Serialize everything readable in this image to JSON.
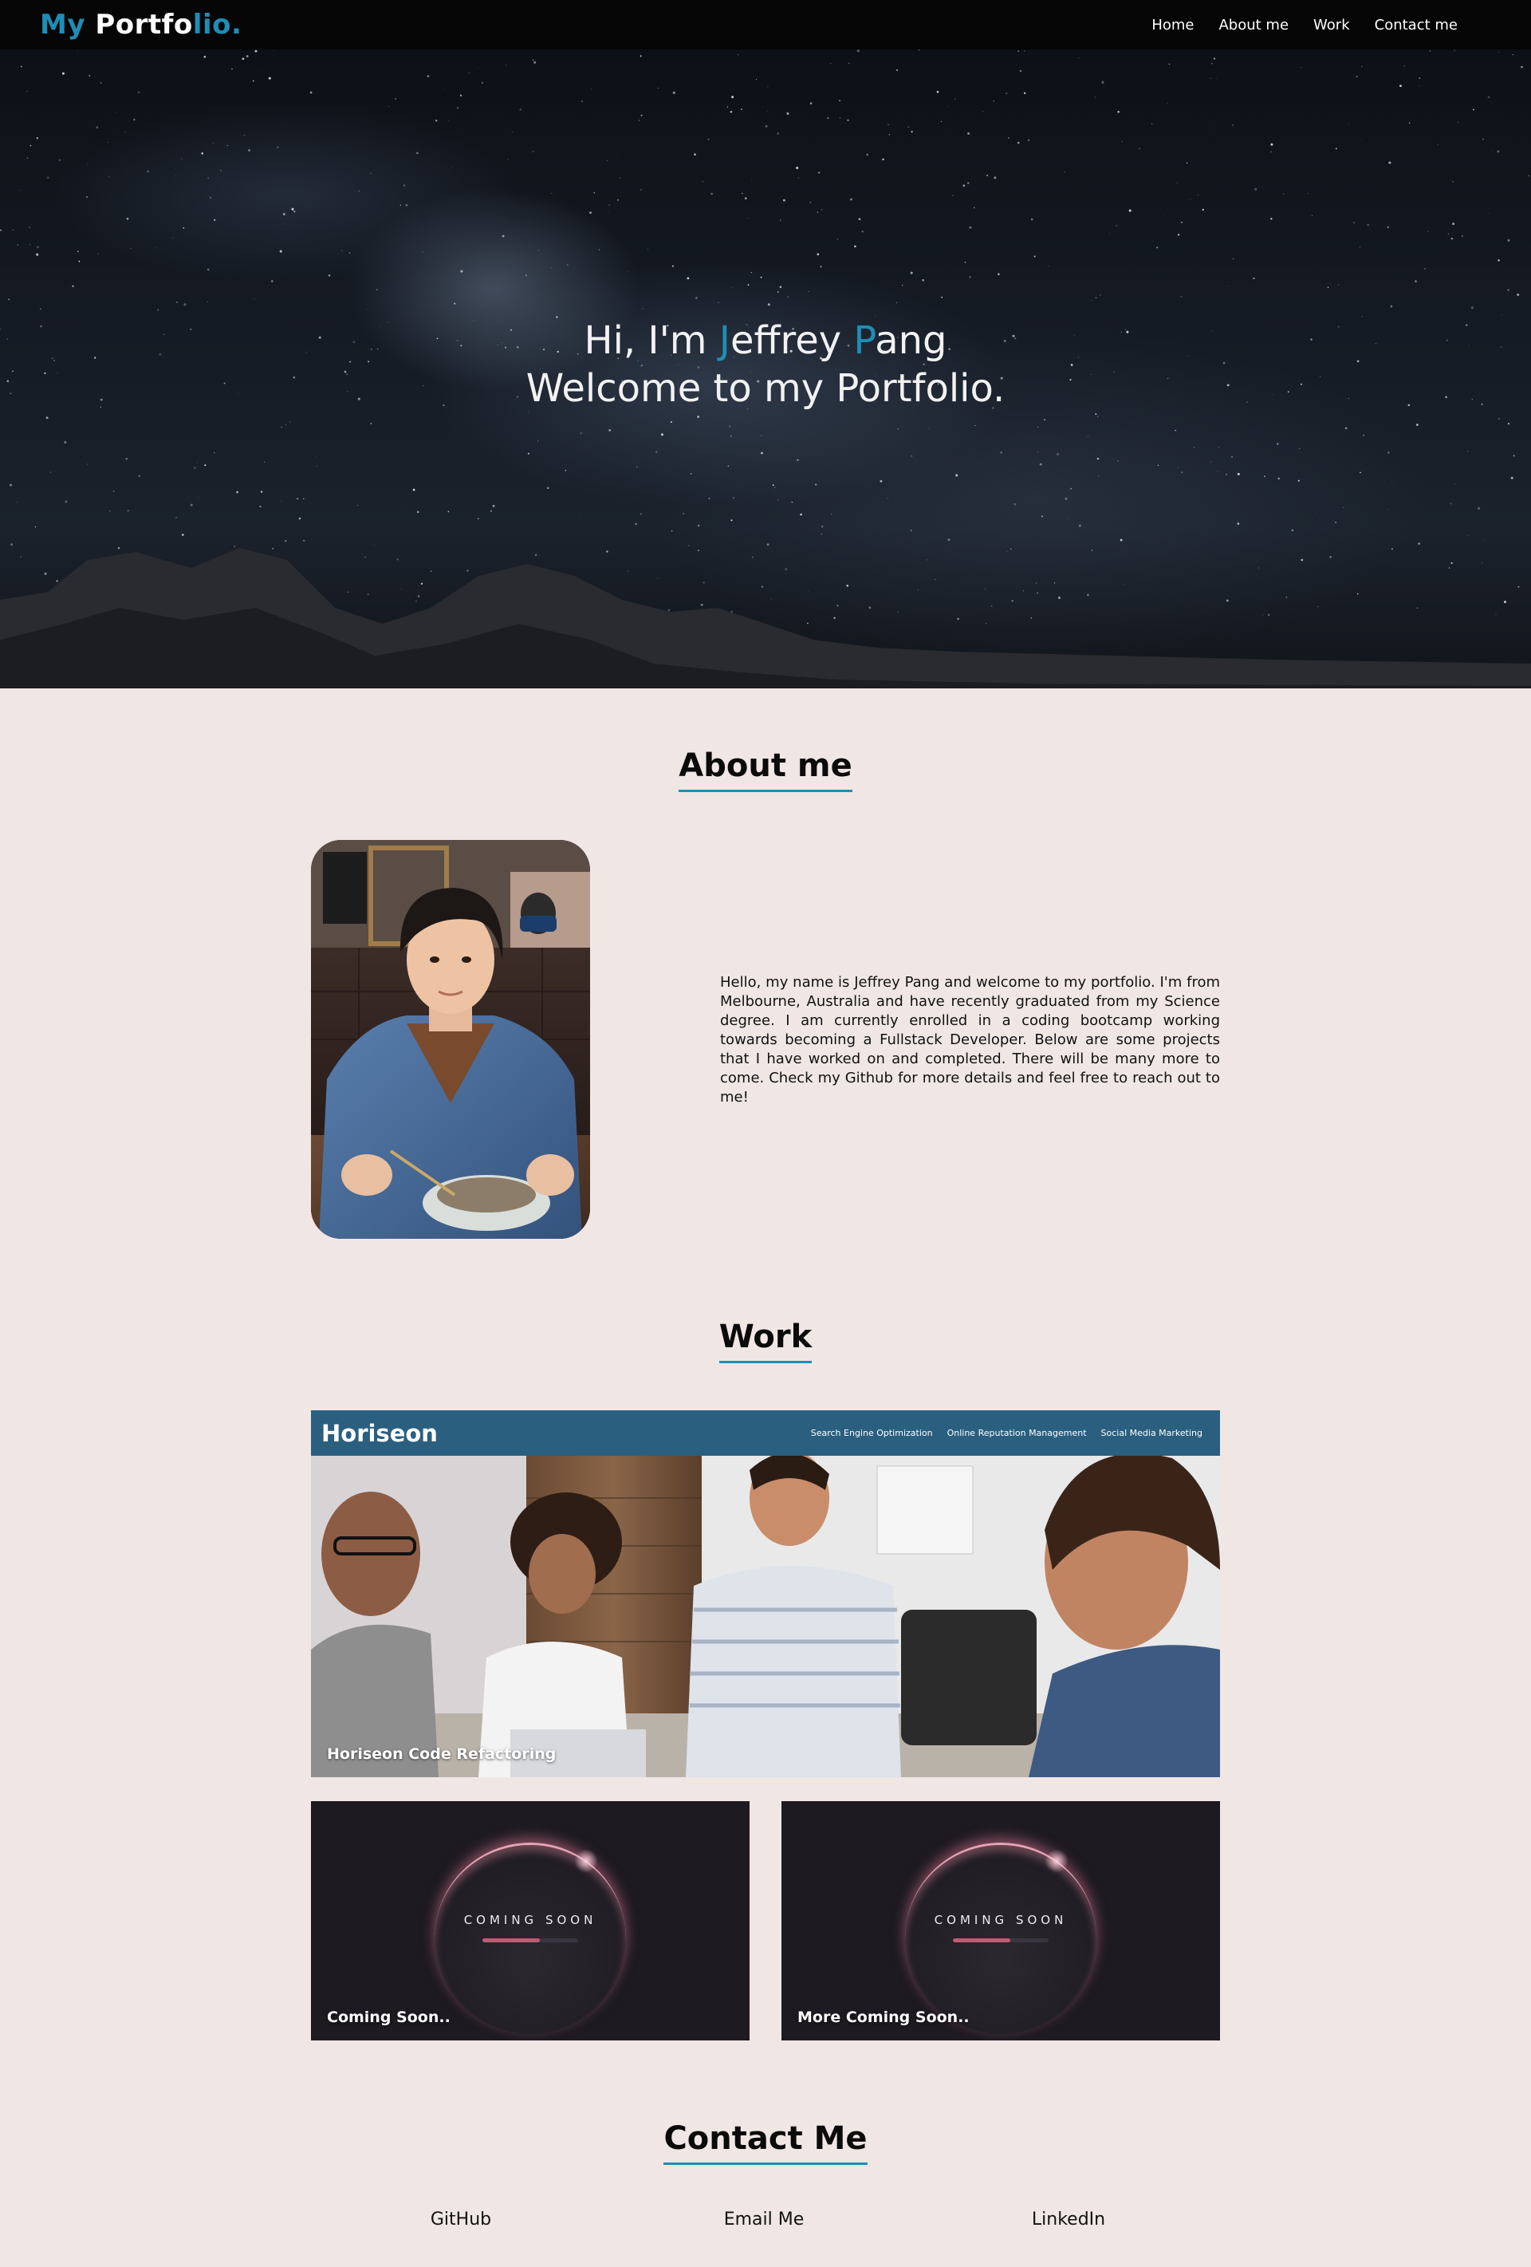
{
  "nav": {
    "brand": {
      "part1": "My ",
      "part2": "Portfo",
      "part3": "lio."
    },
    "links": [
      "Home",
      "About me",
      "Work",
      "Contact me"
    ]
  },
  "hero": {
    "line1_pre": "Hi, I'm ",
    "line1_j": "J",
    "line1_mid": "effrey ",
    "line1_p": "P",
    "line1_end": "ang",
    "line2": "Welcome to my Portfolio."
  },
  "about": {
    "title": "About me",
    "text": "Hello, my name is Jeffrey Pang and welcome to my portfolio. I'm from Melbourne, Australia and have recently graduated from my Science degree. I am currently enrolled in a coding bootcamp working towards becoming a Fullstack Developer. Below are some projects that I have worked on and completed. There will be many more to come. Check my Github for more details and feel free to reach out to me!"
  },
  "work": {
    "title": "Work",
    "featured": {
      "label": "Horiseon Code Refactoring",
      "preview_logo": "Horiseon",
      "preview_nav": [
        "Search Engine Optimization",
        "Online Reputation Management",
        "Social Media Marketing"
      ]
    },
    "cards": [
      {
        "label": "Coming Soon..",
        "image_text": "COMING SOON",
        "progress": 0.6
      },
      {
        "label": "More Coming Soon..",
        "image_text": "COMING SOON",
        "progress": 0.6
      }
    ]
  },
  "contact": {
    "title": "Contact Me",
    "links": [
      "GitHub",
      "Email Me",
      "LinkedIn"
    ]
  },
  "colors": {
    "accent": "#1e8eb6",
    "nav_bg": "#050505",
    "page_bg": "#f0e7e5",
    "horiseon_bar": "#2a5f80"
  }
}
